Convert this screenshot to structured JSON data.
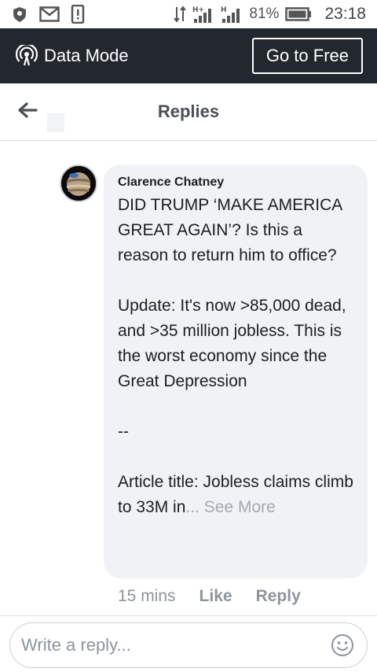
{
  "status_bar": {
    "battery_pct": "81%",
    "time": "23:18",
    "icons": [
      "shield-icon",
      "gmail-icon",
      "phone-alert-icon",
      "data-transfer-icon",
      "signal-h-plus-icon",
      "signal-h-icon",
      "battery-icon"
    ]
  },
  "data_mode": {
    "label": "Data Mode",
    "go_free_label": "Go to Free"
  },
  "header": {
    "title": "Replies"
  },
  "comment": {
    "author": "Clarence Chatney",
    "body": "DID TRUMP ‘MAKE AMERICA GREAT AGAIN’? Is this a reason to return him to office?\n\nUpdate:  It's now >85,000 dead, and >35 million jobless.  This is the worst economy since the Great Depression\n\n--\n\nArticle title:  Jobless claims climb to 33M in",
    "ellipsis": "...",
    "see_more": "See More",
    "time": "15 mins",
    "like_label": "Like",
    "reply_label": "Reply"
  },
  "reply_input": {
    "placeholder": "Write a reply..."
  },
  "colors": {
    "data_bar_bg": "#23272e",
    "bubble_bg": "#f0f2f5",
    "muted_text": "#8d949e"
  }
}
